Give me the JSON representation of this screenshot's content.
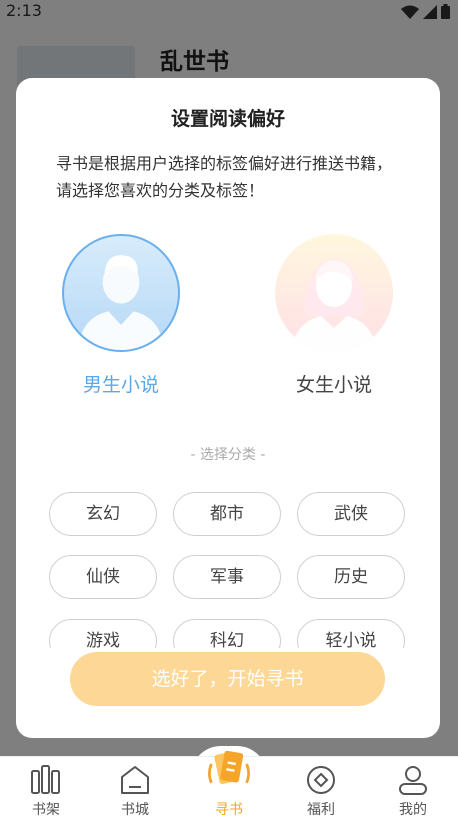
{
  "status_bar": {
    "time": "2:13"
  },
  "background": {
    "book_title": "乱世书"
  },
  "modal": {
    "title": "设置阅读偏好",
    "description": "寻书是根据用户选择的标签偏好进行推送书籍， 请选择您喜欢的分类及标签！",
    "genders": [
      {
        "label": "男生小说",
        "selected": true
      },
      {
        "label": "女生小说",
        "selected": false
      }
    ],
    "category_title": "- 选择分类 -",
    "categories": [
      "玄幻",
      "都市",
      "武侠",
      "仙侠",
      "军事",
      "历史",
      "游戏",
      "科幻",
      "轻小说"
    ],
    "start_button": "选好了，开始寻书"
  },
  "nav": {
    "items": [
      {
        "label": "书架",
        "icon": "bookshelf-icon"
      },
      {
        "label": "书城",
        "icon": "bookstore-icon"
      },
      {
        "label": "寻书",
        "icon": "find-book-icon",
        "active": true
      },
      {
        "label": "福利",
        "icon": "welfare-icon"
      },
      {
        "label": "我的",
        "icon": "profile-icon"
      }
    ]
  },
  "colors": {
    "accent_orange": "#f5a52a",
    "male_blue": "#5aa8ea",
    "button_bg": "#fdd796"
  }
}
